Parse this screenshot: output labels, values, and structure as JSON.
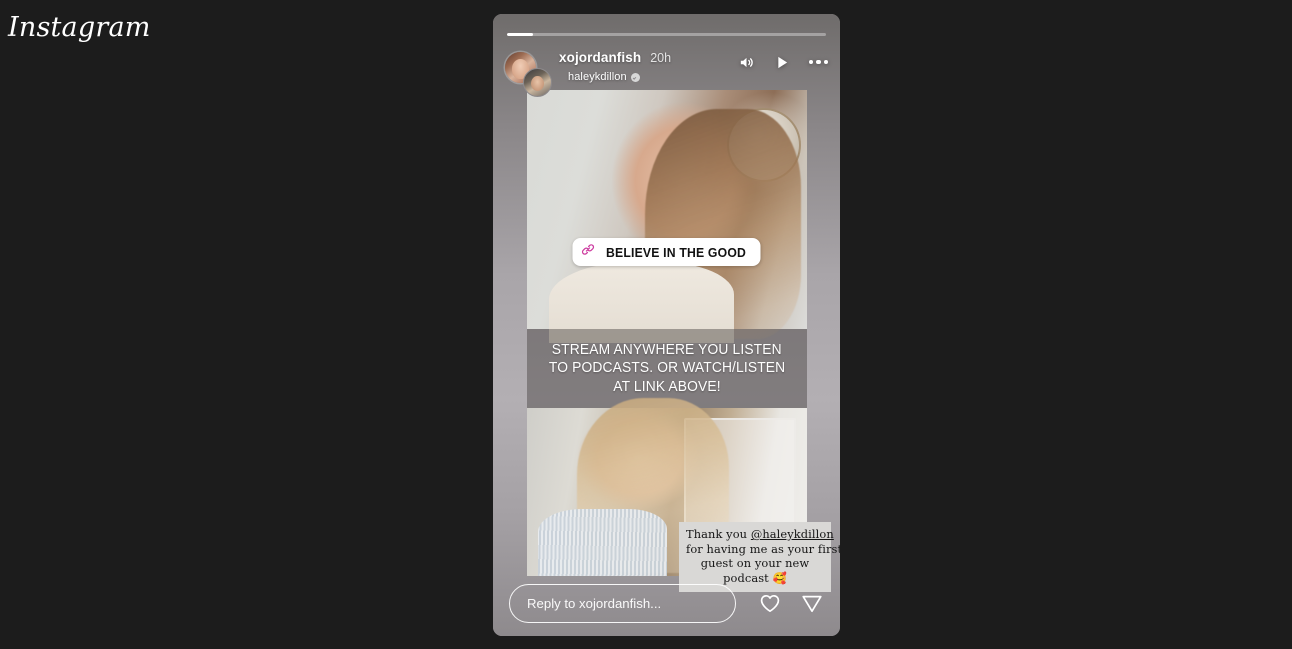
{
  "app": {
    "wordmark": "Instagram",
    "background_color": "#1c1c1c"
  },
  "story": {
    "progress_percent": 8,
    "header": {
      "username": "xojordanfish",
      "timestamp": "20h",
      "collaborator": "haleykdillon",
      "verified": true,
      "avatar_main_name": "xojordanfish-avatar",
      "avatar_sub_name": "haleykdillon-avatar",
      "controls": [
        {
          "icon": "sound-on-icon",
          "label": "Sound on"
        },
        {
          "icon": "play-icon",
          "label": "Play"
        },
        {
          "icon": "more-options-icon",
          "label": "More options"
        }
      ]
    },
    "link_sticker": {
      "icon": "link-chain-icon",
      "label": "BELIEVE IN THE GOOD",
      "icon_gradient_start": "#f9436b",
      "icon_gradient_end": "#a034d4"
    },
    "caption": {
      "lines": [
        "STREAM ANYWHERE YOU LISTEN",
        "TO PODCASTS. OR WATCH/LISTEN",
        "AT LINK ABOVE!"
      ]
    },
    "thanks_sticker": {
      "line1_prefix": "Thank you ",
      "line1_mention": "@haleykdillon",
      "line2": "for having me as your first",
      "line3": "guest on your new",
      "line4": "podcast 🥰"
    },
    "reply": {
      "placeholder": "Reply to xojordanfish...",
      "value": "",
      "actions": [
        {
          "icon": "heart-icon",
          "label": "Like"
        },
        {
          "icon": "share-icon",
          "label": "Share"
        }
      ]
    }
  }
}
